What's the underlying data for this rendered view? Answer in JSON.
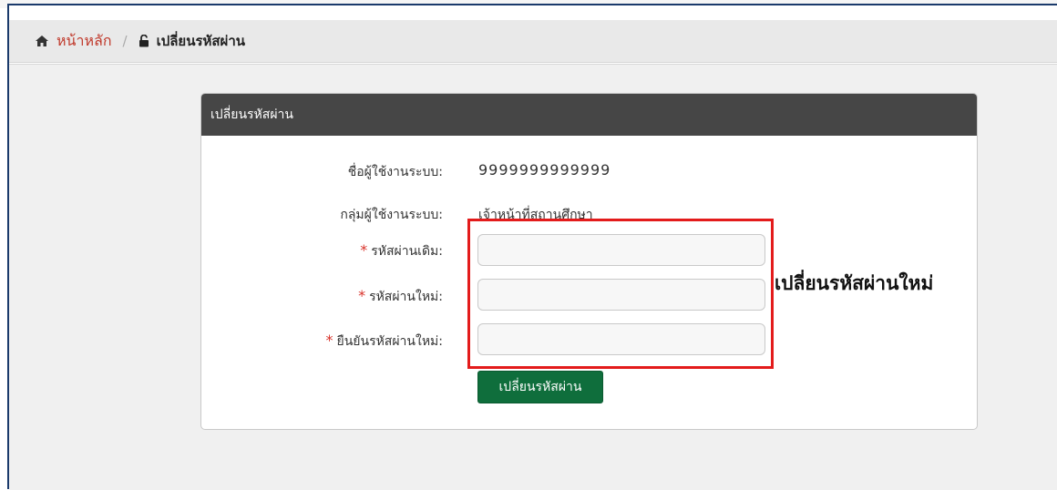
{
  "breadcrumb": {
    "home_label": "หน้าหลัก",
    "separator": "/",
    "current_label": "เปลี่ยนรหัสผ่าน",
    "home_icon": "home-icon",
    "lock_icon": "unlock-icon"
  },
  "panel": {
    "title": "เปลี่ยนรหัสผ่าน",
    "username_label": "ชื่อผู้ใช้งานระบบ:",
    "username_value": "9999999999999",
    "group_label": "กลุ่มผู้ใช้งานระบบ:",
    "group_value": "เจ้าหน้าที่สถานศึกษา",
    "required_mark": "*",
    "old_password_label": "รหัสผ่านเดิม:",
    "old_password_value": "",
    "new_password_label": "รหัสผ่านใหม่:",
    "new_password_value": "",
    "confirm_password_label": "ยืนยันรหัสผ่านใหม่:",
    "confirm_password_value": "",
    "submit_label": "เปลี่ยนรหัสผ่าน"
  },
  "annotation": {
    "text": "เปลี่ยนรหัสผ่านใหม่"
  },
  "colors": {
    "breadcrumb_link": "#c0392b",
    "panel_header": "#464646",
    "button": "#0f6e3c",
    "highlight": "#e31b1b",
    "required": "#d9332b"
  }
}
